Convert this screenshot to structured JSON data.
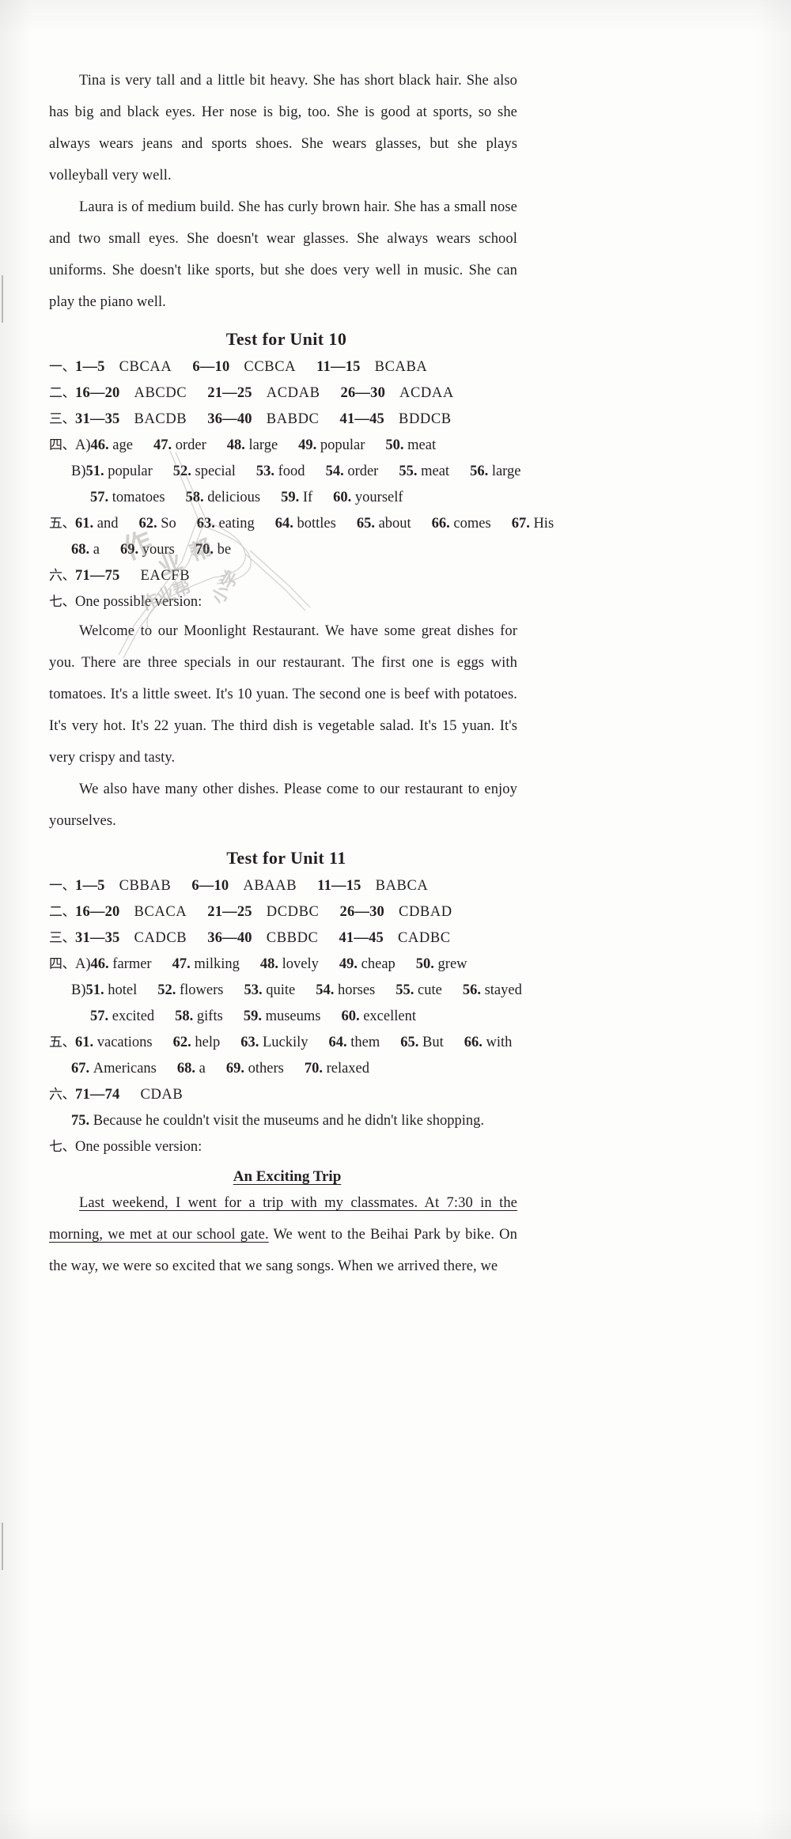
{
  "page": {
    "intro_paragraphs": [
      "Tina is very tall and a little bit heavy. She has short black hair. She also has big and black eyes. Her nose is big, too. She is good at sports, so she always wears jeans and sports shoes. She wears glasses, but she plays volleyball very well.",
      "Laura is of medium build. She has curly brown hair. She has a small nose and two small eyes. She doesn't wear glasses. She always wears school uniforms. She doesn't like sports, but she does very well in music. She can play the piano well."
    ]
  },
  "unit10": {
    "heading": "Test for Unit 10",
    "section1": {
      "cn": "一、",
      "groups": [
        {
          "range": "1—5",
          "answer": "CBCAA"
        },
        {
          "range": "6—10",
          "answer": "CCBCA"
        },
        {
          "range": "11—15",
          "answer": "BCABA"
        }
      ]
    },
    "section2": {
      "cn": "二、",
      "groups": [
        {
          "range": "16—20",
          "answer": "ABCDC"
        },
        {
          "range": "21—25",
          "answer": "ACDAB"
        },
        {
          "range": "26—30",
          "answer": "ACDAA"
        }
      ]
    },
    "section3": {
      "cn": "三、",
      "groups": [
        {
          "range": "31—35",
          "answer": "BACDB"
        },
        {
          "range": "36—40",
          "answer": "BABDC"
        },
        {
          "range": "41—45",
          "answer": "BDDCB"
        }
      ]
    },
    "section4": {
      "cn": "四、",
      "partA_label": "A)",
      "partA": [
        {
          "no": "46.",
          "word": "age"
        },
        {
          "no": "47.",
          "word": "order"
        },
        {
          "no": "48.",
          "word": "large"
        },
        {
          "no": "49.",
          "word": "popular"
        },
        {
          "no": "50.",
          "word": "meat"
        }
      ],
      "partB_label": "B)",
      "partB_row1": [
        {
          "no": "51.",
          "word": "popular"
        },
        {
          "no": "52.",
          "word": "special"
        },
        {
          "no": "53.",
          "word": "food"
        },
        {
          "no": "54.",
          "word": "order"
        },
        {
          "no": "55.",
          "word": "meat"
        },
        {
          "no": "56.",
          "word": "large"
        }
      ],
      "partB_row2": [
        {
          "no": "57.",
          "word": "tomatoes"
        },
        {
          "no": "58.",
          "word": "delicious"
        },
        {
          "no": "59.",
          "word": "If"
        },
        {
          "no": "60.",
          "word": "yourself"
        }
      ]
    },
    "section5": {
      "cn": "五、",
      "row1": [
        {
          "no": "61.",
          "word": "and"
        },
        {
          "no": "62.",
          "word": "So"
        },
        {
          "no": "63.",
          "word": "eating"
        },
        {
          "no": "64.",
          "word": "bottles"
        },
        {
          "no": "65.",
          "word": "about"
        },
        {
          "no": "66.",
          "word": "comes"
        },
        {
          "no": "67.",
          "word": "His"
        }
      ],
      "row2": [
        {
          "no": "68.",
          "word": "a"
        },
        {
          "no": "69.",
          "word": "yours"
        },
        {
          "no": "70.",
          "word": "be"
        }
      ]
    },
    "section6": {
      "cn": "六、",
      "range": "71—75",
      "answer": "EACFB"
    },
    "section7": {
      "cn": "七、",
      "label": "One possible version:",
      "paragraphs": [
        "Welcome to our Moonlight Restaurant. We have some great dishes for you. There are three specials in our restaurant. The first one is eggs with tomatoes. It's a little sweet. It's 10 yuan. The second one is beef with potatoes. It's very hot. It's 22 yuan. The third dish is vegetable salad. It's 15 yuan. It's very crispy and tasty.",
        "We also have many other dishes. Please come to our restaurant to enjoy yourselves."
      ]
    }
  },
  "unit11": {
    "heading": "Test for Unit 11",
    "section1": {
      "cn": "一、",
      "groups": [
        {
          "range": "1—5",
          "answer": "CBBAB"
        },
        {
          "range": "6—10",
          "answer": "ABAAB"
        },
        {
          "range": "11—15",
          "answer": "BABCA"
        }
      ]
    },
    "section2": {
      "cn": "二、",
      "groups": [
        {
          "range": "16—20",
          "answer": "BCACA"
        },
        {
          "range": "21—25",
          "answer": "DCDBC"
        },
        {
          "range": "26—30",
          "answer": "CDBAD"
        }
      ]
    },
    "section3": {
      "cn": "三、",
      "groups": [
        {
          "range": "31—35",
          "answer": "CADCB"
        },
        {
          "range": "36—40",
          "answer": "CBBDC"
        },
        {
          "range": "41—45",
          "answer": "CADBC"
        }
      ]
    },
    "section4": {
      "cn": "四、",
      "partA_label": "A)",
      "partA": [
        {
          "no": "46.",
          "word": "farmer"
        },
        {
          "no": "47.",
          "word": "milking"
        },
        {
          "no": "48.",
          "word": "lovely"
        },
        {
          "no": "49.",
          "word": "cheap"
        },
        {
          "no": "50.",
          "word": "grew"
        }
      ],
      "partB_label": "B)",
      "partB_row1": [
        {
          "no": "51.",
          "word": "hotel"
        },
        {
          "no": "52.",
          "word": "flowers"
        },
        {
          "no": "53.",
          "word": "quite"
        },
        {
          "no": "54.",
          "word": "horses"
        },
        {
          "no": "55.",
          "word": "cute"
        },
        {
          "no": "56.",
          "word": "stayed"
        }
      ],
      "partB_row2": [
        {
          "no": "57.",
          "word": "excited"
        },
        {
          "no": "58.",
          "word": "gifts"
        },
        {
          "no": "59.",
          "word": "museums"
        },
        {
          "no": "60.",
          "word": "excellent"
        }
      ]
    },
    "section5": {
      "cn": "五、",
      "row1": [
        {
          "no": "61.",
          "word": "vacations"
        },
        {
          "no": "62.",
          "word": "help"
        },
        {
          "no": "63.",
          "word": "Luckily"
        },
        {
          "no": "64.",
          "word": "them"
        },
        {
          "no": "65.",
          "word": "But"
        },
        {
          "no": "66.",
          "word": "with"
        }
      ],
      "row2": [
        {
          "no": "67.",
          "word": "Americans"
        },
        {
          "no": "68.",
          "word": "a"
        },
        {
          "no": "69.",
          "word": "others"
        },
        {
          "no": "70.",
          "word": "relaxed"
        }
      ]
    },
    "section6": {
      "cn": "六、",
      "range": "71—74",
      "answer": "CDAB",
      "q75_no": "75.",
      "q75_text": "Because he couldn't visit the museums and he didn't like shopping."
    },
    "section7": {
      "cn": "七、",
      "label": "One possible version:",
      "comp_title": "An Exciting Trip",
      "underlined_text": "Last weekend, I went for a trip with my classmates. At 7:30 in the morning, we met at our school gate.",
      "rest_text": "We went to the Beihai Park by bike. On the way, we were so excited that we sang songs. When we arrived there, we"
    }
  },
  "watermark": {
    "text": "作业帮小学"
  }
}
